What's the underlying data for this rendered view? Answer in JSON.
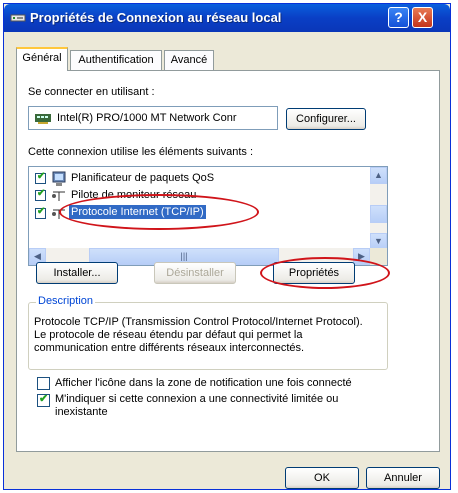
{
  "window": {
    "title": "Propriétés de Connexion au réseau local",
    "help_button": "?",
    "close_button": "X"
  },
  "tabs": [
    {
      "label": "Général"
    },
    {
      "label": "Authentification"
    },
    {
      "label": "Avancé"
    }
  ],
  "general": {
    "connect_using_label": "Se connecter en utilisant :",
    "adapter_name": "Intel(R) PRO/1000 MT Network Conr",
    "configure_button": "Configurer...",
    "components_label": "Cette connexion utilise les éléments suivants :",
    "components": [
      {
        "label": "Planificateur de paquets QoS",
        "checked": true,
        "icon": "qos-icon"
      },
      {
        "label": "Pilote de moniteur réseau",
        "checked": true,
        "icon": "network-monitor-icon"
      },
      {
        "label": "Protocole Internet (TCP/IP)",
        "checked": true,
        "icon": "protocol-icon",
        "selected": true
      }
    ],
    "install_button": "Installer...",
    "uninstall_button": "Désinstaller",
    "properties_button": "Propriétés",
    "description_title": "Description",
    "description_text": "Protocole TCP/IP (Transmission Control Protocol/Internet Protocol). Le protocole de réseau étendu par défaut qui permet la communication entre différents réseaux interconnectés.",
    "show_icon_label": "Afficher l'icône dans la zone de notification une fois connecté",
    "show_icon_checked": false,
    "notify_label": "M'indiquer si cette connexion a une connectivité limitée ou inexistante",
    "notify_checked": true
  },
  "footer": {
    "ok_button": "OK",
    "cancel_button": "Annuler"
  },
  "colors": {
    "titlebar": "#0a5fdd",
    "selection": "#316ac5",
    "annotation": "#d0141a"
  }
}
